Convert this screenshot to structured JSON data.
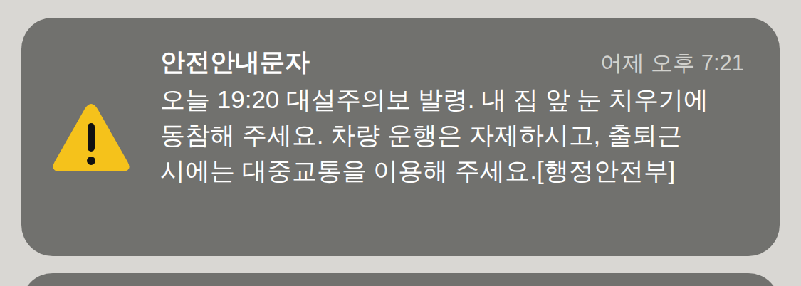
{
  "notifications": [
    {
      "app": "안전안내문자",
      "time": "어제 오후 7:21",
      "body": "오늘 19:20 대설주의보 발령. 내 집 앞 눈 치우기에 동참해 주세요. 차량 운행은 자제하시고, 출퇴근 시에는 대중교통을 이용해 주세요.[행정안전부]"
    }
  ]
}
